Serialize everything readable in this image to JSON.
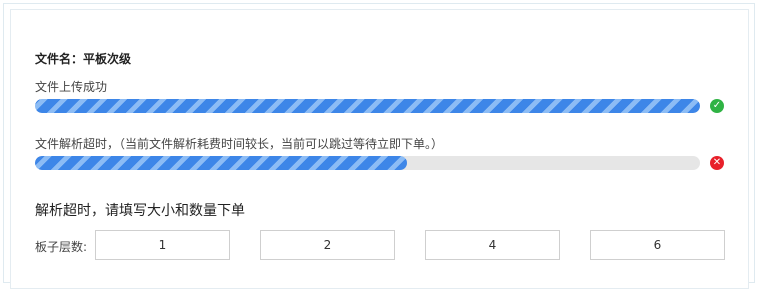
{
  "file": {
    "name_label": "文件名：平板次级"
  },
  "upload": {
    "status_text": "文件上传成功",
    "progress": 1.0,
    "state_icon": "check-circle-icon",
    "state_color": "#2fb344"
  },
  "parse": {
    "status_text": "文件解析超时，（当前文件解析耗费时间较长，当前可以跳过等待立即下单。）",
    "progress": 0.56,
    "state_icon": "close-circle-icon",
    "state_color": "#e8202a"
  },
  "manual": {
    "title": "解析超时，请填写大小和数量下单",
    "layers_label": "板子层数:",
    "layer_options": [
      "1",
      "2",
      "4",
      "6"
    ]
  },
  "colors": {
    "accent": "#3d86e8",
    "stripe": "#8cbcf5",
    "track": "#e6e6e6"
  }
}
